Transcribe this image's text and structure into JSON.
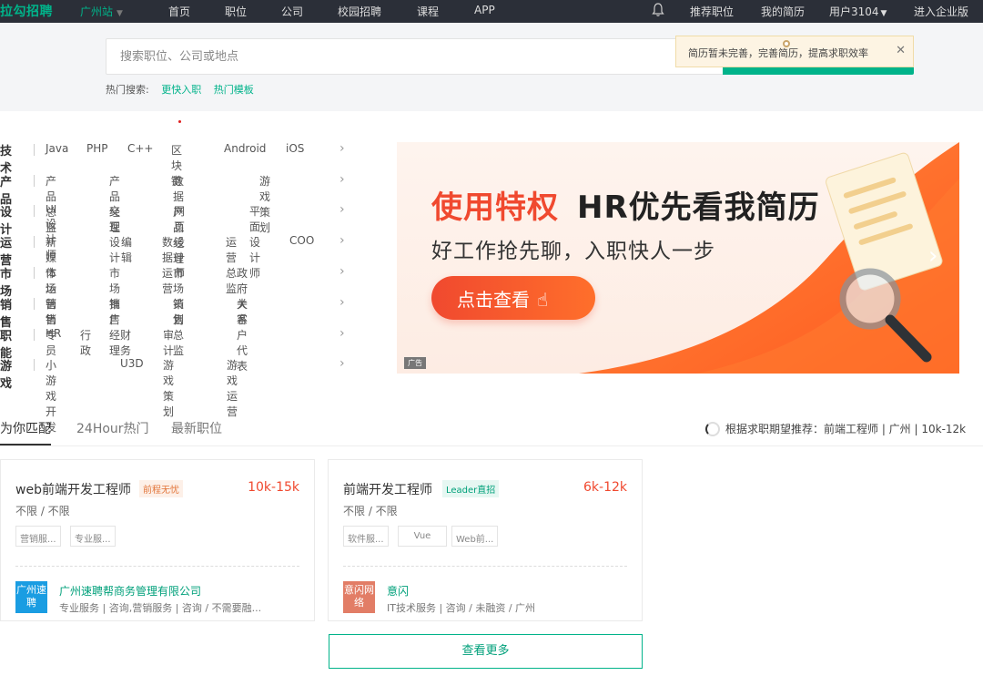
{
  "topbar": {
    "logo": "拉勾招聘",
    "city": "广州站",
    "nav": [
      "首页",
      "职位",
      "公司",
      "校园招聘",
      "课程",
      "APP"
    ],
    "right": [
      "推荐职位",
      "我的简历",
      "用户3104",
      "进入企业版"
    ]
  },
  "search": {
    "placeholder": "搜索职位、公司或地点",
    "hot_label": "热门搜索:",
    "hot_links": [
      "更快入职",
      "热门模板"
    ]
  },
  "tip": {
    "text": "简历暂未完善，完善简历，提高求职效率"
  },
  "categories": [
    {
      "title": "技术",
      "items": [
        "Java",
        "PHP",
        "C++",
        "区块链",
        "Android",
        "iOS"
      ]
    },
    {
      "title": "产品",
      "items": [
        "产品总监",
        "产品经理",
        "数据产品经理",
        "游戏策划"
      ]
    },
    {
      "title": "设计",
      "items": [
        "UI设计师",
        "交互设计",
        "网页设计师",
        "平面设计师"
      ]
    },
    {
      "title": "运营",
      "items": [
        "新媒体运营",
        "编辑",
        "数据运营",
        "运营总监",
        "COO"
      ]
    },
    {
      "title": "市场",
      "items": [
        "市场营销",
        "市场推广",
        "市场策划",
        "政府关系"
      ]
    },
    {
      "title": "销售",
      "items": [
        "销售专员",
        "销售经理",
        "销售总监",
        "大客户代表"
      ]
    },
    {
      "title": "职能",
      "items": [
        "HR",
        "行政",
        "财务",
        "审计"
      ]
    },
    {
      "title": "游戏",
      "items": [
        "小游戏开发",
        "U3D",
        "游戏策划",
        "游戏运营"
      ]
    }
  ],
  "banner": {
    "headline_a": "使用特权",
    "headline_b": "HR优先看我简历",
    "subline": "好工作抢先聊，入职快人一步",
    "cta": "点击查看",
    "ad_label": "广告"
  },
  "tabs": {
    "items": [
      "为你匹配",
      "24Hour热门",
      "最新职位"
    ],
    "recommend": "根据求职期望推荐：前端工程师 | 广州 | 10k-12k"
  },
  "jobs": [
    {
      "title": "web前端开发工程师",
      "badge": "前程无忧",
      "salary": "10k-15k",
      "req": "不限 / 不限",
      "tags": [
        "营销服...",
        "专业服..."
      ],
      "logo_text": "广州速聘",
      "company": "广州速聘帮商务管理有限公司",
      "info": "专业服务 | 咨询,营销服务 | 咨询 / 不需要融..."
    },
    {
      "title": "前端开发工程师",
      "badge": "Leader直招",
      "salary": "6k-12k",
      "req": "不限 / 不限",
      "tags": [
        "软件服...",
        "Vue",
        "Web前..."
      ],
      "logo_text": "意闪网络",
      "company": "意闪",
      "info": "IT技术服务 | 咨询 / 未融资 / 广州"
    }
  ],
  "more_button": "查看更多",
  "colors": {
    "brand": "#00b38a",
    "salary": "#f0492f",
    "nav_bg": "#2b2f38"
  }
}
